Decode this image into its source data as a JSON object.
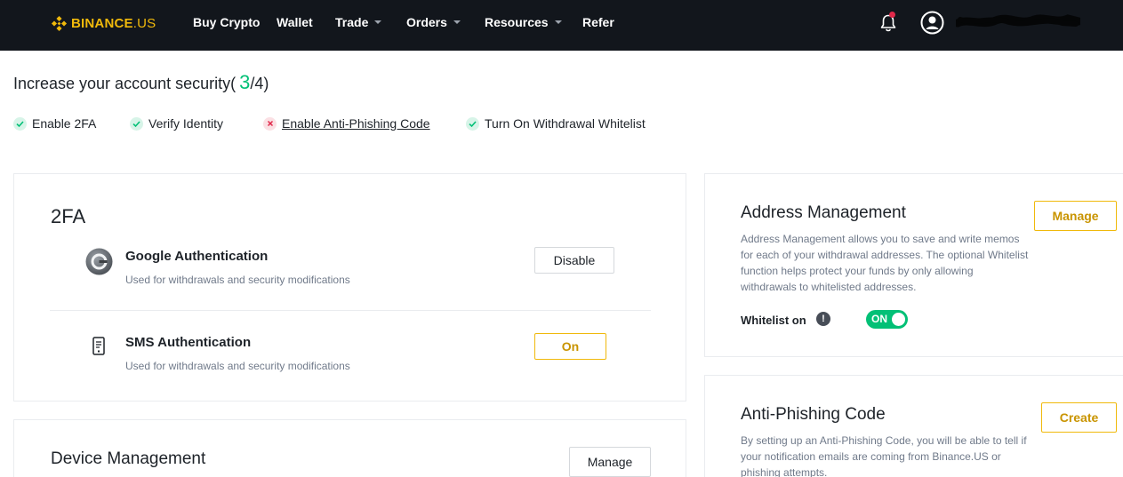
{
  "nav": {
    "brand_main": "BINANCE",
    "brand_suffix": ".US",
    "items": [
      {
        "label": "Buy Crypto",
        "dropdown": false
      },
      {
        "label": "Wallet",
        "dropdown": false
      },
      {
        "label": "Trade",
        "dropdown": true
      },
      {
        "label": "Orders",
        "dropdown": true
      },
      {
        "label": "Resources",
        "dropdown": true
      },
      {
        "label": "Refer",
        "dropdown": false
      }
    ],
    "icons": [
      "bell-icon",
      "user-icon"
    ],
    "notification_dot_color": "#e0294a"
  },
  "security": {
    "title_prefix": "Increase your account security(",
    "count": "3",
    "total_suffix": "/4)",
    "checks": [
      {
        "label": "Enable 2FA",
        "status": "done"
      },
      {
        "label": "Verify Identity",
        "status": "done"
      },
      {
        "label": "Enable Anti-Phishing Code",
        "status": "todo"
      },
      {
        "label": "Turn On Withdrawal Whitelist",
        "status": "done"
      }
    ]
  },
  "twofa": {
    "title": "2FA",
    "google": {
      "title": "Google Authentication",
      "desc": "Used for withdrawals and security modifications",
      "button": "Disable"
    },
    "sms": {
      "title": "SMS Authentication",
      "desc": "Used for withdrawals and security modifications",
      "button": "On"
    }
  },
  "device": {
    "title": "Device Management",
    "button": "Manage"
  },
  "address": {
    "title": "Address Management",
    "button": "Manage",
    "desc_lines": [
      "Address Management allows you to save and write memos",
      "for each of your withdrawal addresses. The optional Whitelist",
      "function helps protect your funds by only allowing",
      "withdrawals to whitelisted addresses."
    ],
    "whitelist_label": "Whitelist on",
    "toggle_label": "ON",
    "toggle_on": true
  },
  "antiphishing": {
    "title": "Anti-Phishing Code",
    "button": "Create",
    "desc_lines": [
      "By setting up an Anti-Phishing Code, you will be able to tell if",
      "your notification emails are coming from Binance.US or",
      "phishing attempts."
    ]
  },
  "colors": {
    "brand": "#f0b90b",
    "success": "#02c076",
    "error": "#e0294a",
    "nav_bg": "#12161c"
  }
}
